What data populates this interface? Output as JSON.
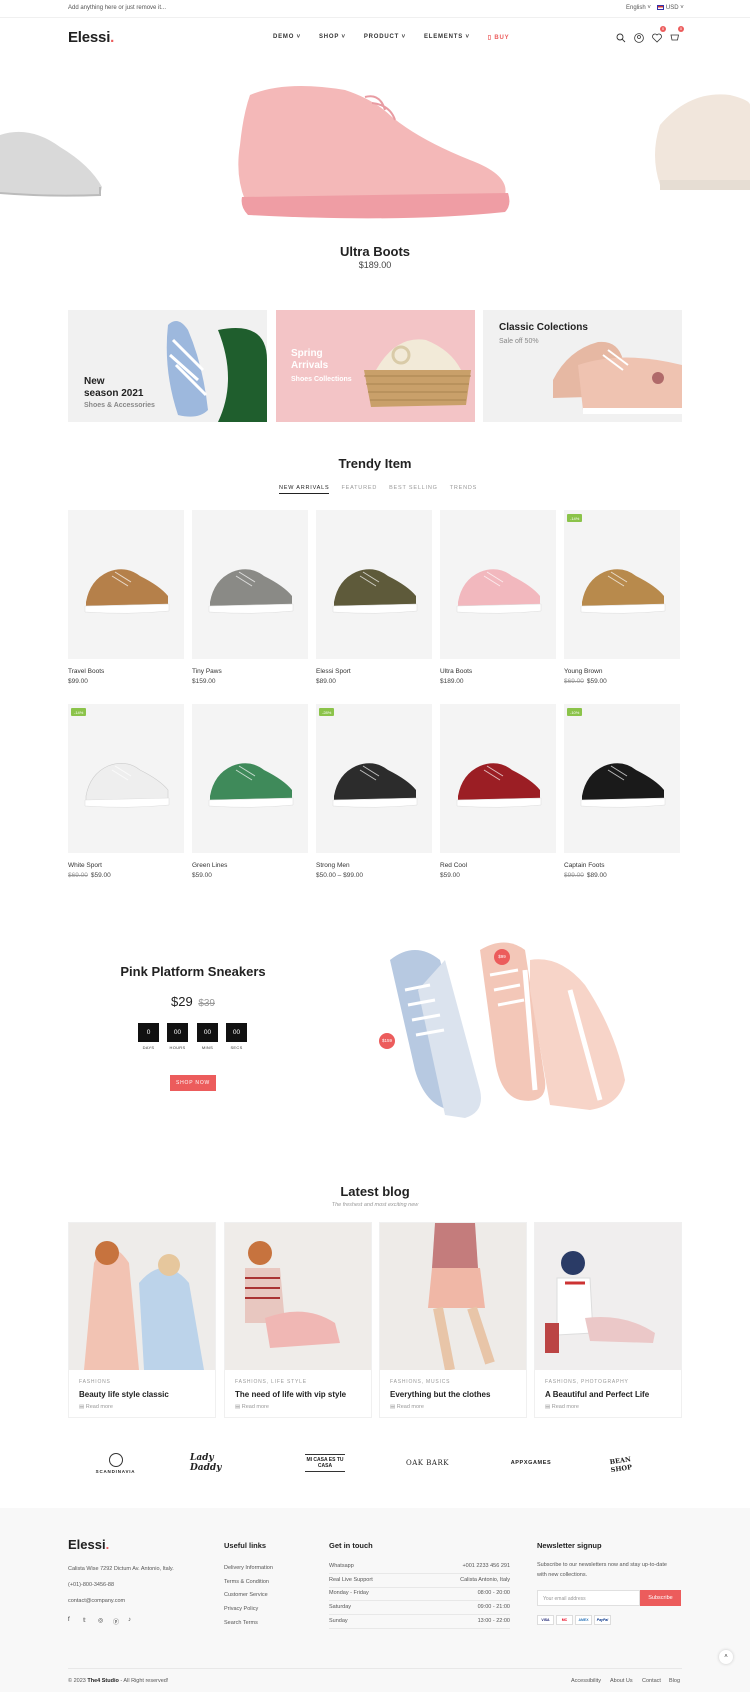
{
  "topbar": {
    "announcement": "Add anything here or just remove it...",
    "language": "English",
    "currency": "USD"
  },
  "header": {
    "logo": "Elessi",
    "logo_dot": ".",
    "nav": [
      "DEMO",
      "SHOP",
      "PRODUCT",
      "ELEMENTS"
    ],
    "buy": "BUY",
    "wishlist_count": "0",
    "cart_count": "0"
  },
  "hero": {
    "title": "Ultra Boots",
    "price": "$189.00"
  },
  "banners": [
    {
      "line1": "New",
      "line2": "season 2021",
      "sub": "Shoes & Accessories"
    },
    {
      "line1": "Spring",
      "line2": "Arrivals",
      "sub": "Shoes Collections"
    },
    {
      "line1": "Classic Colections",
      "sub": "Sale off 50%"
    }
  ],
  "trendy": {
    "title": "Trendy Item",
    "tabs": [
      "NEW ARRIVALS",
      "FEATURED",
      "BEST SELLING",
      "TRENDS"
    ],
    "products": [
      {
        "name": "Travel Boots",
        "price": "$99.00",
        "old": "",
        "badge": "",
        "color": "#b5804a"
      },
      {
        "name": "Tiny Paws",
        "price": "$159.00",
        "old": "",
        "badge": "",
        "color": "#8a8a86"
      },
      {
        "name": "Elessi Sport",
        "price": "$89.00",
        "old": "",
        "badge": "",
        "color": "#5e5a3a"
      },
      {
        "name": "Ultra Boots",
        "price": "$189.00",
        "old": "",
        "badge": "",
        "color": "#f2b8be"
      },
      {
        "name": "Young Brown",
        "price": "$59.00",
        "old": "$69.00",
        "badge": "-14%",
        "color": "#b88a4c"
      },
      {
        "name": "White Sport",
        "price": "$59.00",
        "old": "$69.00",
        "badge": "-14%",
        "color": "#eeeeee"
      },
      {
        "name": "Green Lines",
        "price": "$59.00",
        "old": "",
        "badge": "",
        "color": "#3f8a5a"
      },
      {
        "name": "Strong Men",
        "price": "$50.00 – $99.00",
        "old": "",
        "badge": "-28%",
        "color": "#2c2c2c"
      },
      {
        "name": "Red Cool",
        "price": "$59.00",
        "old": "",
        "badge": "",
        "color": "#9b1e24"
      },
      {
        "name": "Captain Foots",
        "price": "$89.00",
        "old": "$99.00",
        "badge": "-10%",
        "color": "#1a1a1a"
      }
    ]
  },
  "deal": {
    "title": "Pink Platform Sneakers",
    "price": "$29",
    "old_price": "$39",
    "countdown": [
      {
        "value": "0",
        "unit": "DAYS"
      },
      {
        "value": "00",
        "unit": "HOURS"
      },
      {
        "value": "00",
        "unit": "MINS"
      },
      {
        "value": "00",
        "unit": "SECS"
      }
    ],
    "button": "SHOP NOW",
    "tag1": "$99",
    "tag2": "$159"
  },
  "blog": {
    "title": "Latest blog",
    "subtitle": "The freshest and most exciting new",
    "posts": [
      {
        "category": "FASHIONS",
        "title": "Beauty life style classic",
        "read": "Read more"
      },
      {
        "category": "FASHIONS, LIFE STYLE",
        "title": "The need of life with vip style",
        "read": "Read more"
      },
      {
        "category": "FASHIONS, MUSICS",
        "title": "Everything but the clothes",
        "read": "Read more"
      },
      {
        "category": "FASHIONS, PHOTOGRAPHY",
        "title": "A Beautiful and Perfect Life",
        "read": "Read more"
      }
    ]
  },
  "brands": [
    "SCANDINAVIA",
    "Lady Daddy",
    "MI CASA ES TU CASA",
    "OAK BARK",
    "APPXGAMES",
    "BEAN SHOP"
  ],
  "footer": {
    "logo": "Elessi",
    "address": "Calista Wise 7292 Dictum Av. Antonio, Italy.",
    "phone": "(+01)-800-3456-88",
    "email": "contact@company.com",
    "useful_title": "Useful links",
    "useful_links": [
      "Delivery Information",
      "Terms & Condition",
      "Customer Service",
      "Privacy Policy",
      "Search Terms"
    ],
    "contact_title": "Get in touch",
    "contact_rows": [
      {
        "label": "Whatsapp",
        "value": "+001 2233 456 291"
      },
      {
        "label": "Real Live Support",
        "value": "Calista Antonio, Italy"
      },
      {
        "label": "Monday - Friday",
        "value": "08:00 - 20:00"
      },
      {
        "label": "Saturday",
        "value": "09:00 - 21:00"
      },
      {
        "label": "Sunday",
        "value": "13:00 - 22:00"
      }
    ],
    "newsletter_title": "Newsletter signup",
    "newsletter_text1": "Subscribe to our newsletters now and stay up-to-date",
    "newsletter_text2": "with new collections.",
    "email_placeholder": "Your email address",
    "subscribe": "Subscribe",
    "payments": [
      "VISA",
      "MC",
      "AMEX",
      "PayPal"
    ],
    "copyright_brand": "The4 Studio",
    "copyright_rest": "- All Right reserved!",
    "copyright_year": "© 2023",
    "bottom_links": [
      "Accessibility",
      "About Us",
      "Contact",
      "Blog"
    ]
  }
}
